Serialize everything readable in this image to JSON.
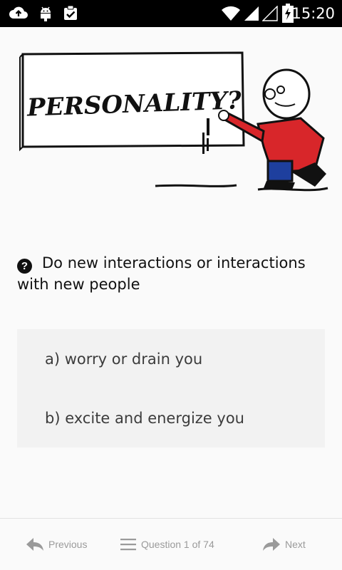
{
  "status_bar": {
    "time": "15:20",
    "icons": [
      "upload-icon",
      "android-icon",
      "clipboard-check-icon",
      "wifi-icon",
      "signal-icon",
      "signal-empty-icon",
      "battery-charging-icon"
    ]
  },
  "banner": {
    "image": "personality-cartoon",
    "text": "PERSONALITY?"
  },
  "question": {
    "icon": "question-icon",
    "text": "Do new interactions or interactions with new people"
  },
  "answers": [
    {
      "label": "a) worry or drain you"
    },
    {
      "label": "b) excite and energize you"
    }
  ],
  "bottom_nav": {
    "previous_label": "Previous",
    "progress_label": "Question 1 of 74",
    "next_label": "Next"
  }
}
